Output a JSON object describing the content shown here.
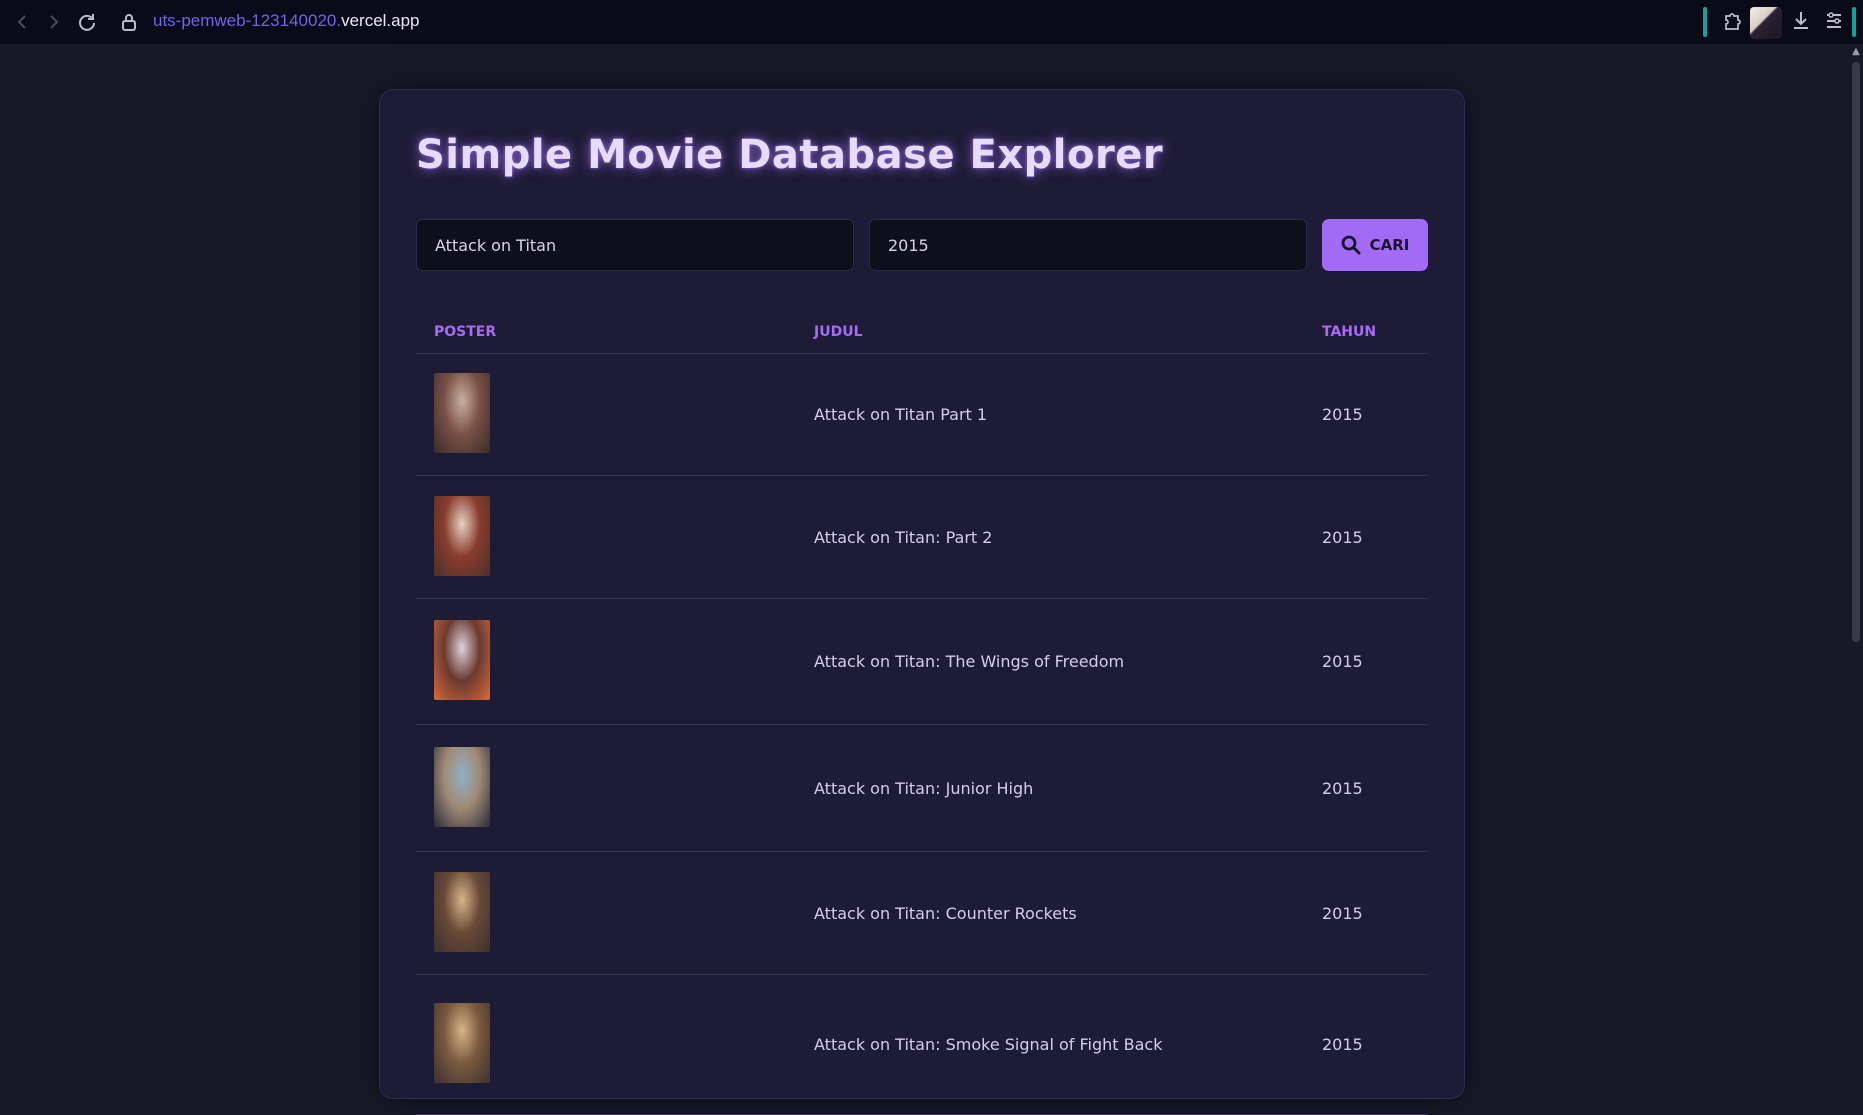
{
  "browser": {
    "url_host": "uts-pemweb-123140020.",
    "url_domain": "vercel.app"
  },
  "app": {
    "title": "Simple Movie Database Explorer"
  },
  "search": {
    "title_value": "Attack on Titan",
    "year_value": "2015",
    "button_label": "CARI"
  },
  "table": {
    "headers": {
      "poster": "POSTER",
      "title": "JUDUL",
      "year": "TAHUN"
    },
    "rows": [
      {
        "title": "Attack on Titan Part 1",
        "year": "2015",
        "poster_colors": [
          "#c9b2a3",
          "#7a5246",
          "#3a2a2c"
        ]
      },
      {
        "title": "Attack on Titan: Part 2",
        "year": "2015",
        "poster_colors": [
          "#e6d2c1",
          "#8a3c2e",
          "#4b3028"
        ]
      },
      {
        "title": "Attack on Titan: The Wings of Freedom",
        "year": "2015",
        "poster_colors": [
          "#dcd2d8",
          "#6a3a30",
          "#d86a38"
        ]
      },
      {
        "title": "Attack on Titan: Junior High",
        "year": "2015",
        "poster_colors": [
          "#8fb2c8",
          "#a08a76",
          "#2a2a38"
        ]
      },
      {
        "title": "Attack on Titan: Counter Rockets",
        "year": "2015",
        "poster_colors": [
          "#d6b48a",
          "#6a4a36",
          "#3a3030"
        ]
      },
      {
        "title": "Attack on Titan: Smoke Signal of Fight Back",
        "year": "2015",
        "poster_colors": [
          "#d8b488",
          "#7a5a3e",
          "#3c3030"
        ]
      }
    ]
  }
}
